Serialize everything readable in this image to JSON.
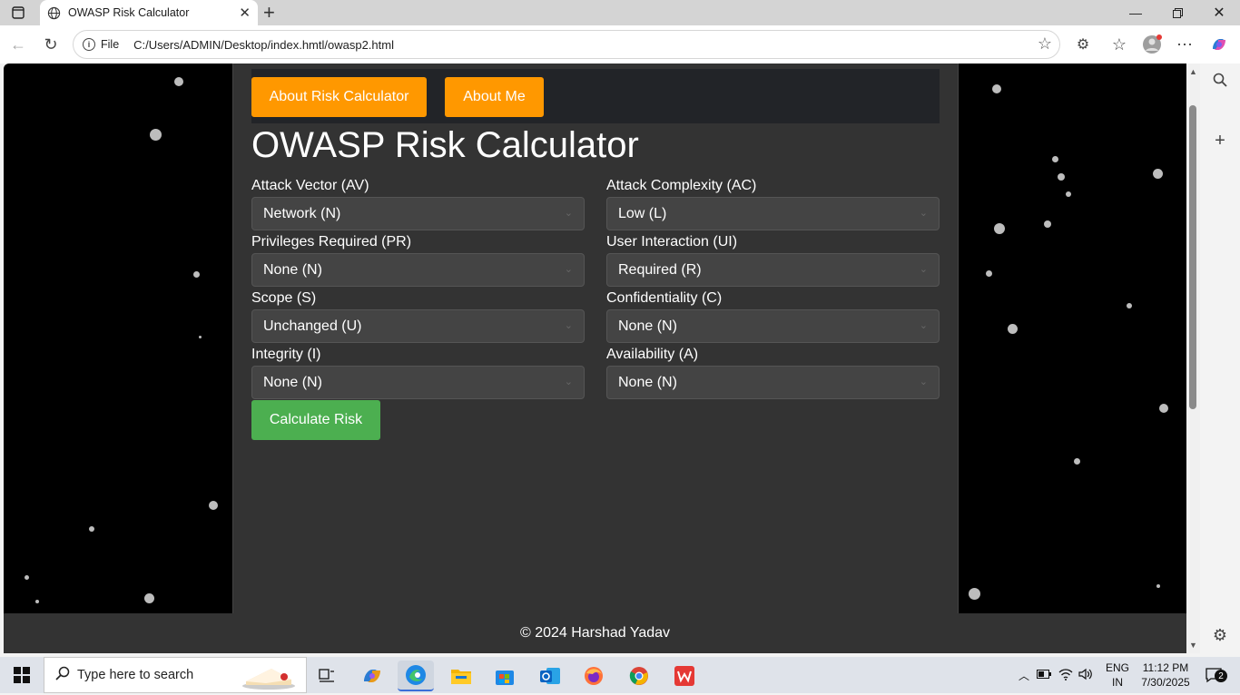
{
  "browser": {
    "tab_title": "OWASP Risk Calculator",
    "protocol_label": "File",
    "url": "C:/Users/ADMIN/Desktop/index.hmtl/owasp2.html"
  },
  "page": {
    "nav": {
      "about_calc": "About Risk Calculator",
      "about_me": "About Me"
    },
    "title": "OWASP Risk Calculator",
    "fields": [
      {
        "label": "Attack Vector (AV)",
        "value": "Network (N)"
      },
      {
        "label": "Attack Complexity (AC)",
        "value": "Low (L)"
      },
      {
        "label": "Privileges Required (PR)",
        "value": "None (N)"
      },
      {
        "label": "User Interaction (UI)",
        "value": "Required (R)"
      },
      {
        "label": "Scope (S)",
        "value": "Unchanged (U)"
      },
      {
        "label": "Confidentiality (C)",
        "value": "None (N)"
      },
      {
        "label": "Integrity (I)",
        "value": "None (N)"
      },
      {
        "label": "Availability (A)",
        "value": "None (N)"
      }
    ],
    "calculate_label": "Calculate Risk",
    "footer": "© 2024 Harshad Yadav"
  },
  "taskbar": {
    "search_placeholder": "Type here to search",
    "lang_line1": "ENG",
    "lang_line2": "IN",
    "time": "11:12 PM",
    "date": "7/30/2025",
    "notification_count": "2"
  },
  "colors": {
    "nav_button": "#ff9800",
    "calculate_button": "#4caf50",
    "container_bg": "#333333",
    "page_bg": "#000000"
  }
}
